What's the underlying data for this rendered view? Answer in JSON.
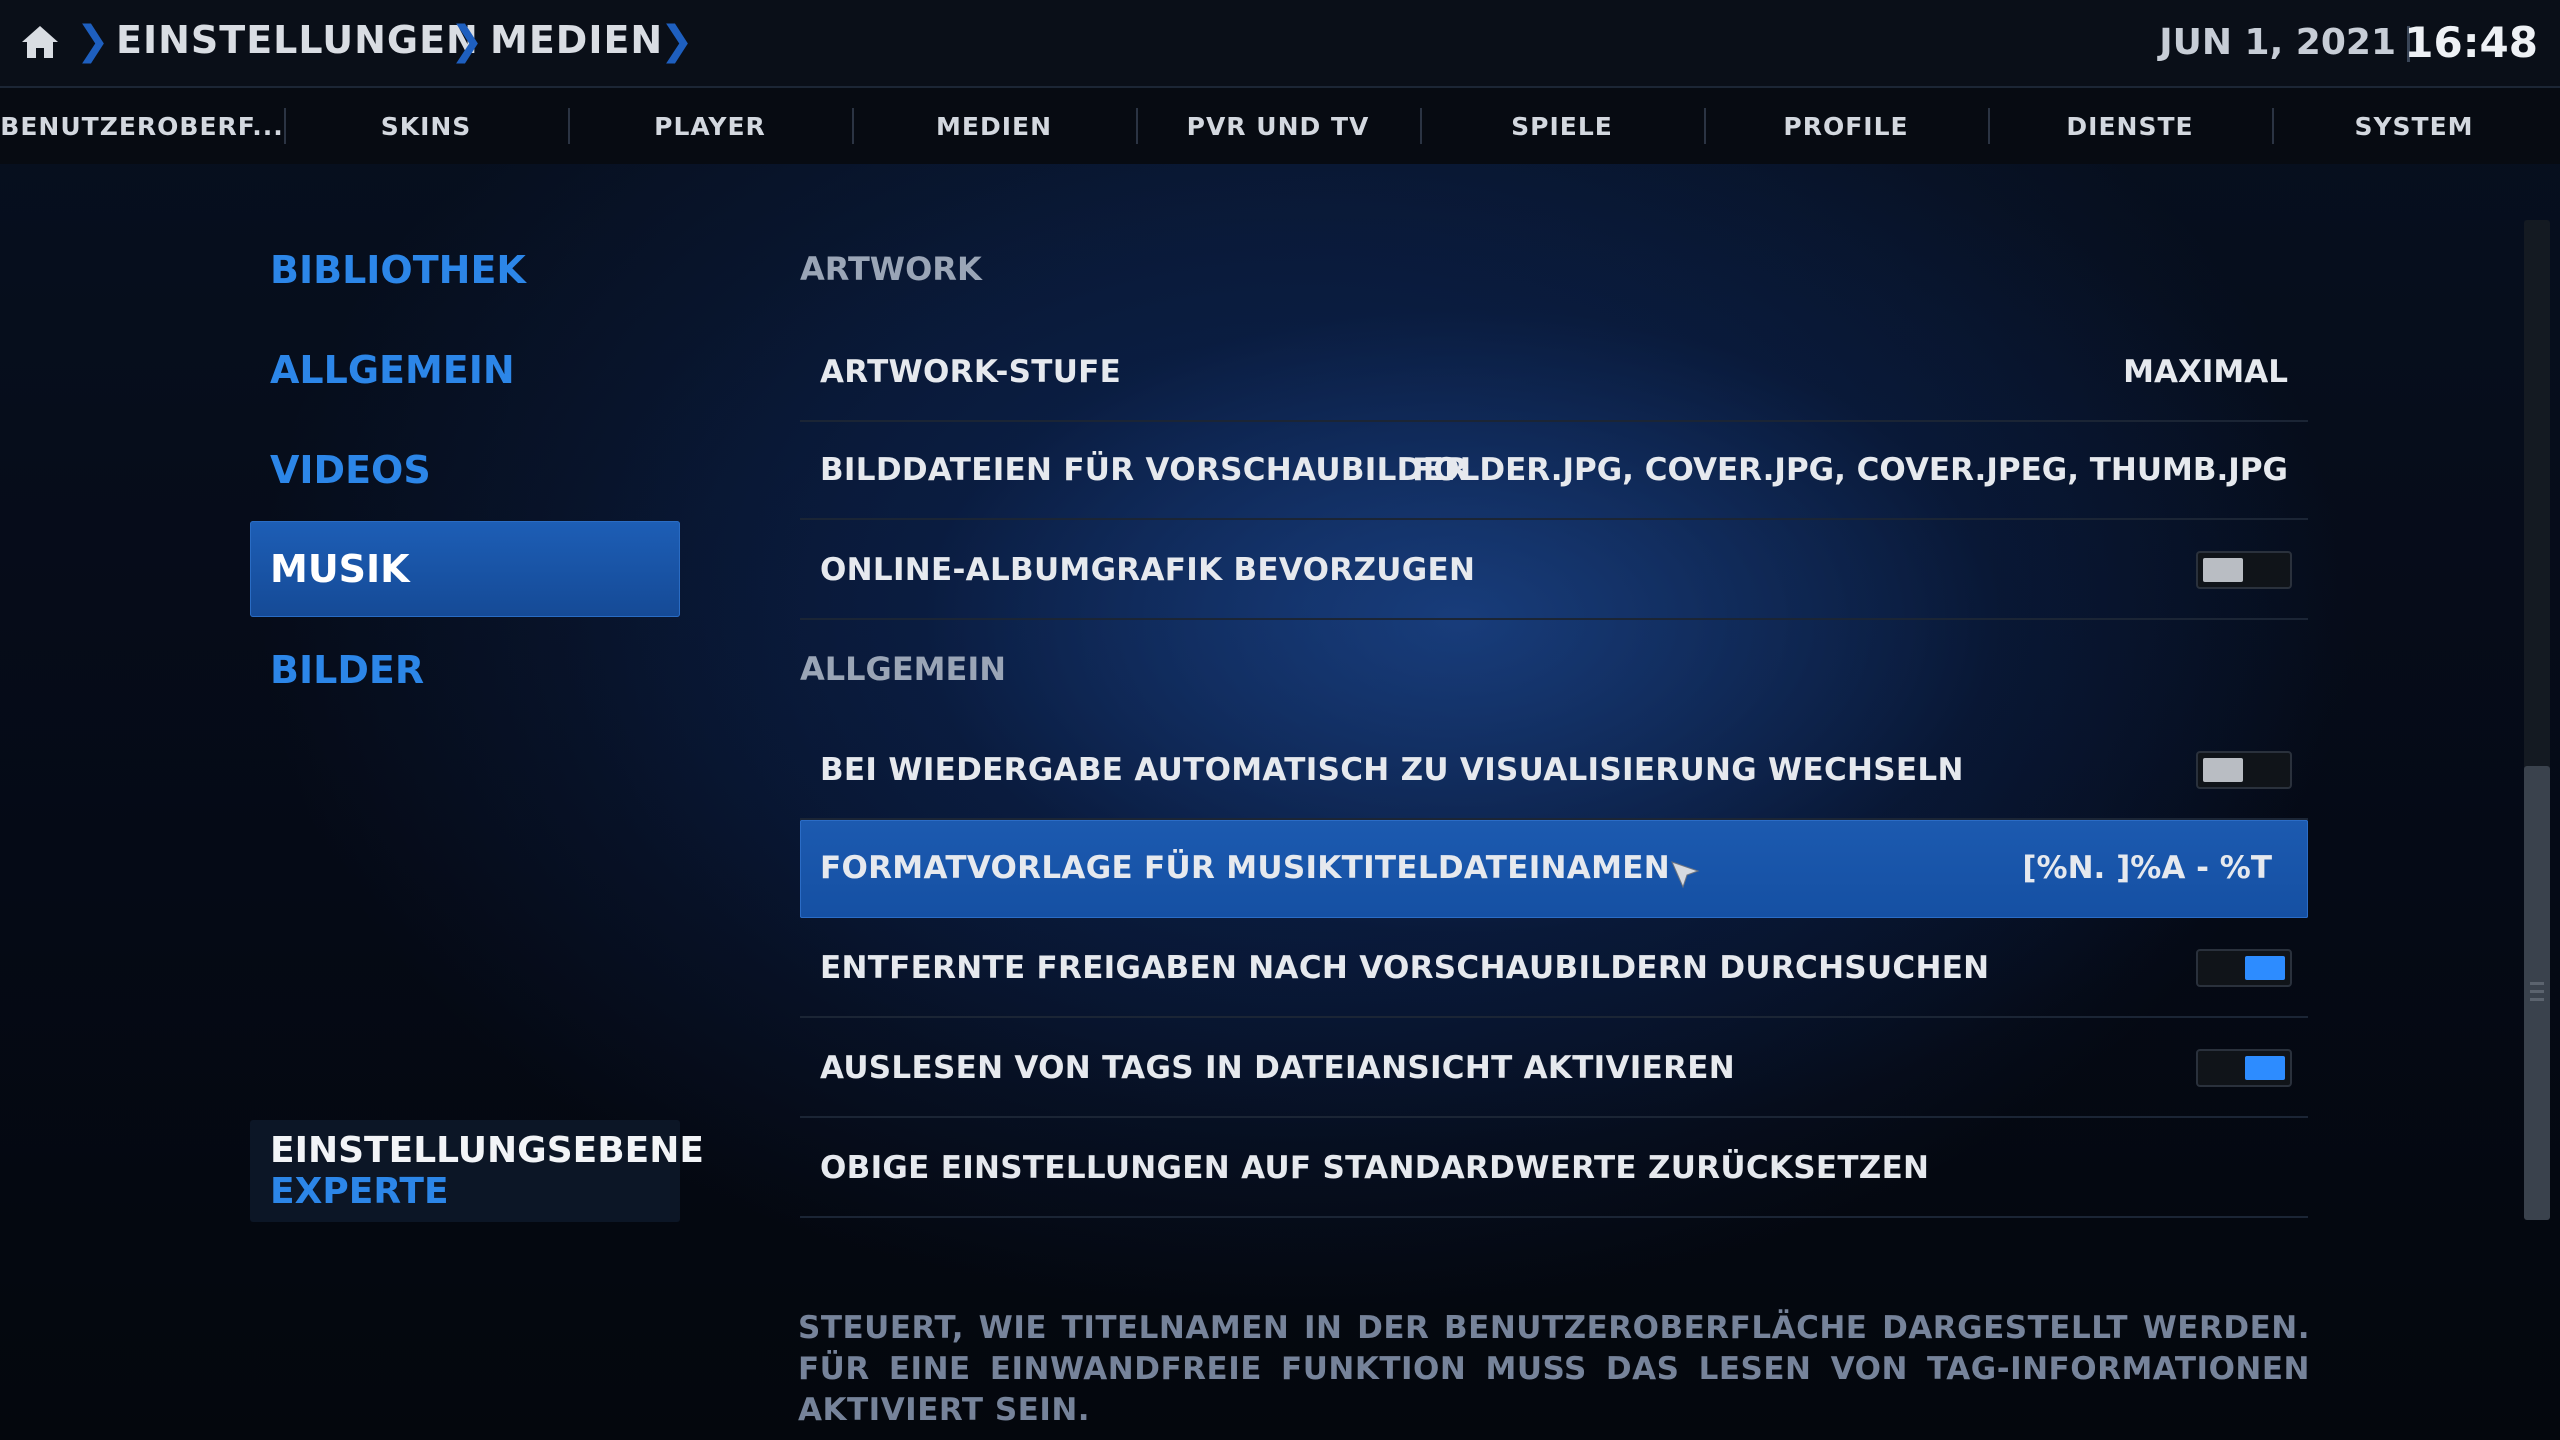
{
  "breadcrumb": {
    "items": [
      "EINSTELLUNGEN",
      "MEDIEN"
    ]
  },
  "clock": {
    "date": "JUN 1, 2021",
    "time": "16:48"
  },
  "tabs": [
    {
      "label": "BENUTZEROBERF..."
    },
    {
      "label": "SKINS"
    },
    {
      "label": "PLAYER"
    },
    {
      "label": "MEDIEN"
    },
    {
      "label": "PVR UND TV"
    },
    {
      "label": "SPIELE"
    },
    {
      "label": "PROFILE"
    },
    {
      "label": "DIENSTE"
    },
    {
      "label": "SYSTEM"
    }
  ],
  "categories": [
    {
      "label": "BIBLIOTHEK"
    },
    {
      "label": "ALLGEMEIN"
    },
    {
      "label": "VIDEOS"
    },
    {
      "label": "MUSIK",
      "active": true
    },
    {
      "label": "BILDER"
    }
  ],
  "settings_level": {
    "title": "EINSTELLUNGSEBENE",
    "value": "EXPERTE"
  },
  "sections": [
    {
      "title": "ARTWORK"
    },
    {
      "title": "ALLGEMEIN"
    }
  ],
  "rows": [
    {
      "label": "ARTWORK-STUFE",
      "value": "MAXIMAL"
    },
    {
      "label": "BILDDATEIEN FÜR VORSCHAUBILDER",
      "value": "FOLDER.JPG, COVER.JPG, COVER.JPEG, THUMB.JPG"
    },
    {
      "label": "ONLINE-ALBUMGRAFIK BEVORZUGEN",
      "toggle": "off"
    },
    {
      "label": "BEI WIEDERGABE AUTOMATISCH ZU VISUALISIERUNG WECHSELN",
      "toggle": "off"
    },
    {
      "label": "FORMATVORLAGE FÜR MUSIKTITELDATEINAMEN",
      "value": "[%N. ]%A - %T",
      "focused": true
    },
    {
      "label": "ENTFERNTE FREIGABEN NACH VORSCHAUBILDERN DURCHSUCHEN",
      "toggle": "on"
    },
    {
      "label": "AUSLESEN VON TAGS IN DATEIANSICHT AKTIVIEREN",
      "toggle": "on"
    },
    {
      "label": "OBIGE EINSTELLUNGEN AUF STANDARDWERTE ZURÜCKSETZEN"
    }
  ],
  "description": "STEUERT, WIE TITELNAMEN IN DER BENUTZEROBERFLÄCHE DARGESTELLT WERDEN. FÜR EINE EINWANDFREIE FUNKTION MUSS DAS LESEN VON TAG-INFORMATIONEN AKTIVIERT SEIN.",
  "colors": {
    "accent": "#2c86e8",
    "focus": "#1c5ab0",
    "toggle_on": "#2d8cff"
  },
  "icons": {
    "home": "home-icon",
    "cursor": "mouse-pointer-icon"
  }
}
